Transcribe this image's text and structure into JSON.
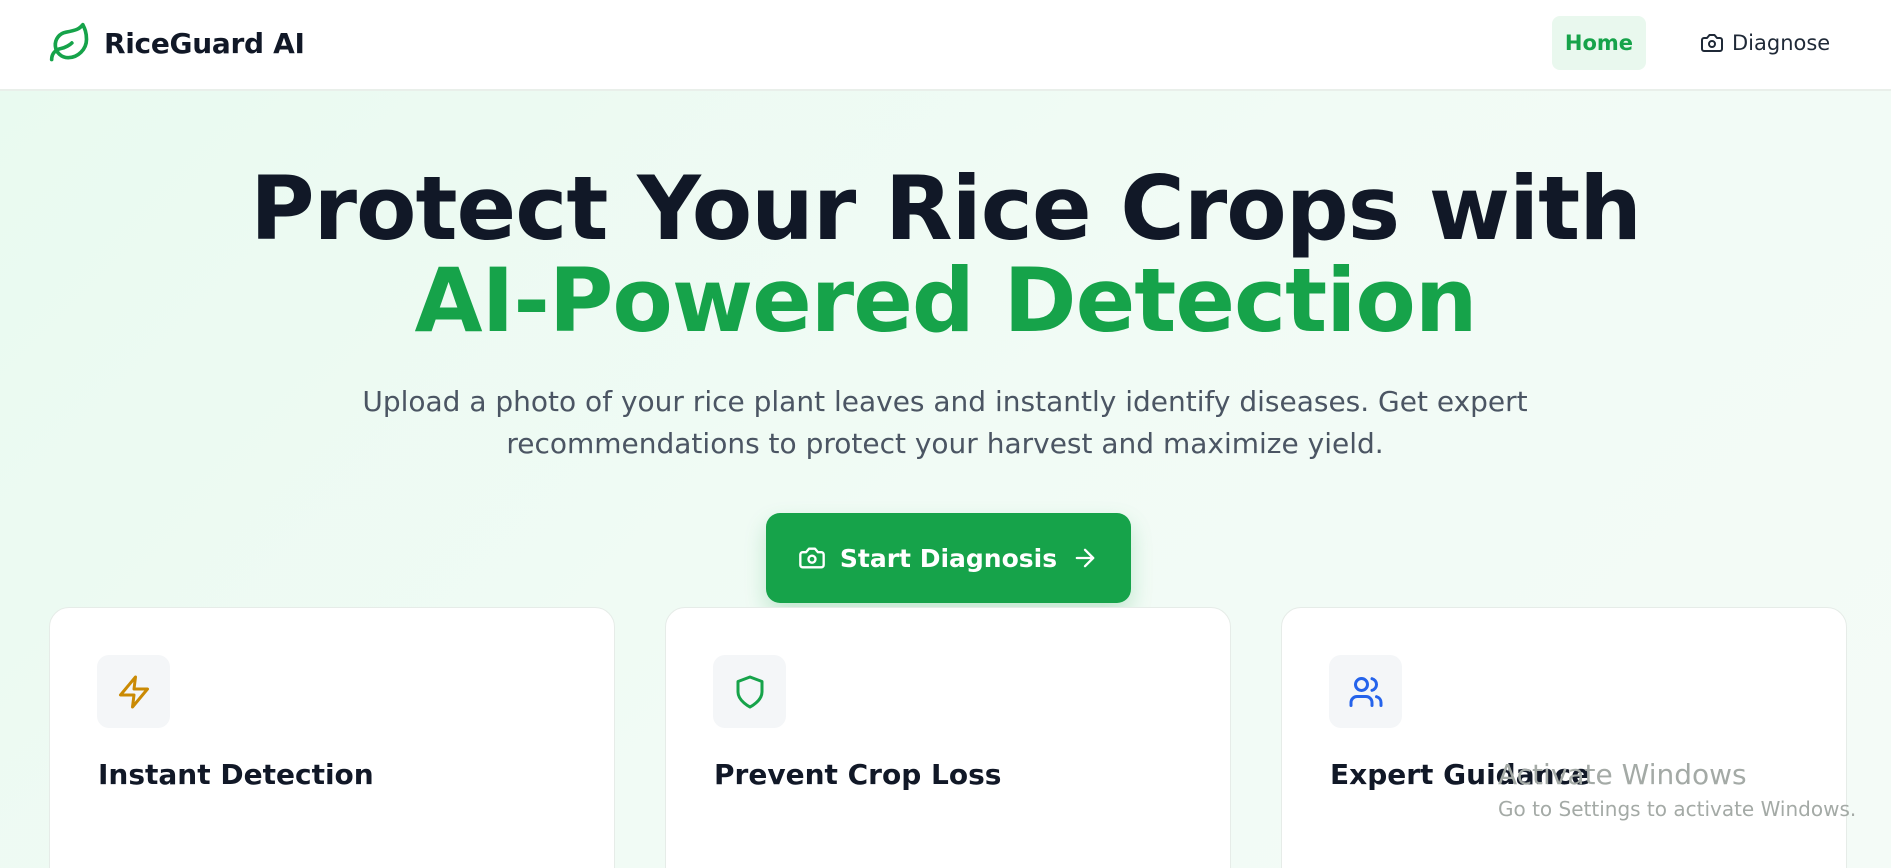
{
  "header": {
    "brand_name": "RiceGuard AI",
    "brand_icon": "leaf-icon",
    "nav": {
      "home_label": "Home",
      "diagnose_label": "Diagnose",
      "diagnose_icon": "camera-icon"
    }
  },
  "hero": {
    "title_line1": "Protect Your Rice Crops with",
    "title_line2": "AI-Powered Detection",
    "subtitle_line1": "Upload a photo of your rice plant leaves and instantly identify diseases. Get expert",
    "subtitle_line2": "recommendations to protect your harvest and maximize yield.",
    "cta_label": "Start Diagnosis",
    "cta_icon": "camera-icon",
    "cta_trailing_icon": "arrow-right-icon"
  },
  "features": [
    {
      "title": "Instant Detection",
      "icon": "lightning-icon",
      "icon_color": "#ca8a04"
    },
    {
      "title": "Prevent Crop Loss",
      "icon": "shield-icon",
      "icon_color": "#16a34a"
    },
    {
      "title": "Expert Guidance",
      "icon": "users-icon",
      "icon_color": "#2563eb"
    }
  ],
  "watermark": {
    "title": "Activate Windows",
    "subtitle": "Go to Settings to activate Windows."
  },
  "colors": {
    "primary": "#16a34a",
    "primary_light": "#e9f8ee",
    "text_dark": "#111827",
    "text_muted": "#4b5563"
  }
}
